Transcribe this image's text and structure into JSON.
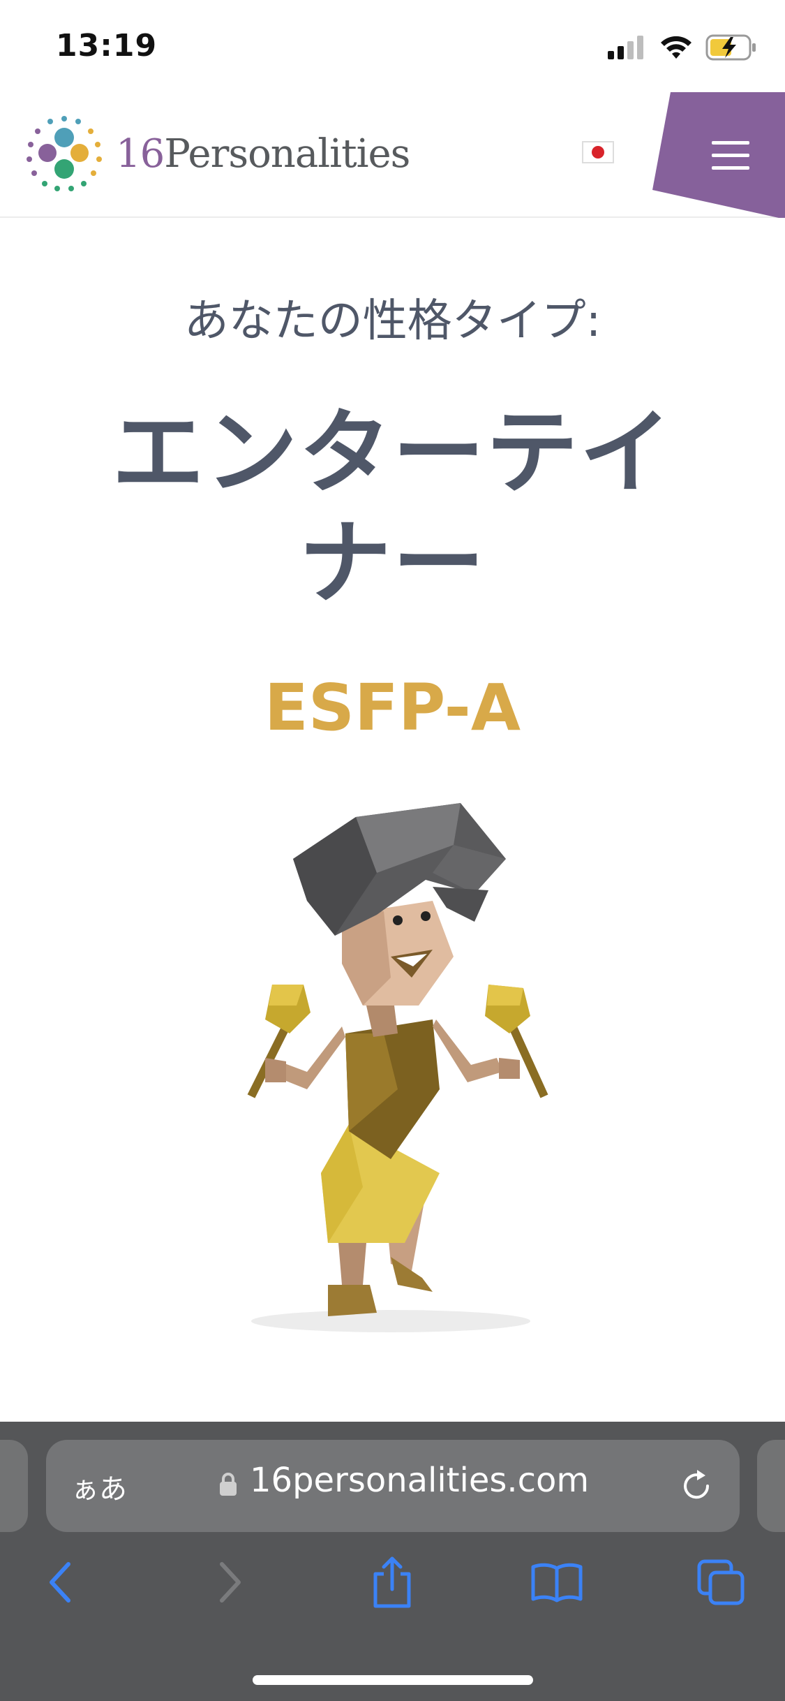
{
  "status_bar": {
    "time": "13:19"
  },
  "header": {
    "logo_number": "16",
    "logo_word": "Personalities",
    "language": "Japanese",
    "menu_icon": "hamburger-icon"
  },
  "result": {
    "kicker": "あなたの性格タイプ:",
    "type_name": "エンターテイナー",
    "type_code": "ESFP-A"
  },
  "browser": {
    "text_size_label": "ぁあ",
    "url": "16personalities.com",
    "toolbar": [
      "back-icon",
      "forward-icon",
      "share-icon",
      "bookmarks-icon",
      "tabs-icon"
    ]
  },
  "colors": {
    "accent_purple": "#88619a",
    "type_gold": "#d8a949",
    "heading_slate": "#4f5768",
    "ios_blue": "#3b82f6"
  }
}
